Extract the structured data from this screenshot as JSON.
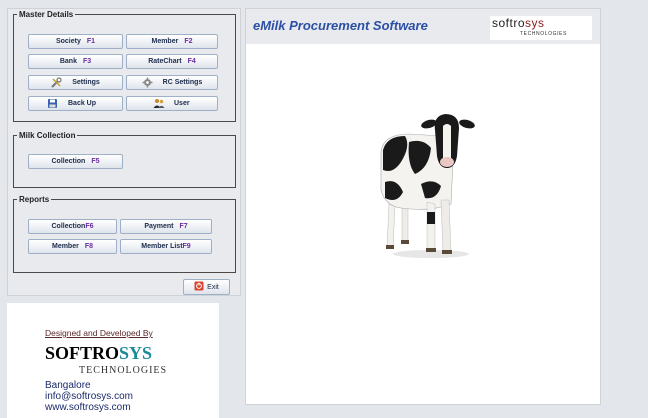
{
  "app": {
    "title": "eMilk Procurement Software"
  },
  "brand_logo": {
    "part1": "softro",
    "part2": "sys",
    "sub": "TECHNOLOGIES"
  },
  "master_details": {
    "legend": "Master Details",
    "buttons": [
      {
        "label": "Society",
        "key": "F1"
      },
      {
        "label": "Member",
        "key": "F2"
      },
      {
        "label": "Bank",
        "key": "F3"
      },
      {
        "label": "RateChart",
        "key": "F4"
      },
      {
        "label": "Settings",
        "key": ""
      },
      {
        "label": "RC Settings",
        "key": ""
      },
      {
        "label": "Back Up",
        "key": ""
      },
      {
        "label": "User",
        "key": ""
      }
    ]
  },
  "milk_collection": {
    "legend": "Milk Collection",
    "buttons": [
      {
        "label": "Collection",
        "key": "F5"
      }
    ]
  },
  "reports": {
    "legend": "Reports",
    "buttons": [
      {
        "label": "Collection",
        "key": "F6"
      },
      {
        "label": "Payment",
        "key": "F7"
      },
      {
        "label": "Member",
        "key": "F8"
      },
      {
        "label": "Member List",
        "key": "F9"
      }
    ]
  },
  "exit": {
    "label": "Exit"
  },
  "company": {
    "designed_by": "Designed and Developed By",
    "name_part1": "SOFTRO",
    "name_part2": "SYS",
    "sub": "TECHNOLOGIES",
    "city": "Bangalore",
    "email": "info@softrosys.com",
    "website": "www.softrosys.com"
  },
  "colors": {
    "title_blue": "#2c4fa6",
    "key_purple": "#6a2ca0",
    "brand_teal": "#1d8a99",
    "brand_red": "#8b1d1d"
  },
  "icons": {
    "settings": "tools-icon",
    "rc_settings": "gear-icon",
    "backup": "disk-icon",
    "user": "users-icon",
    "exit": "exit-icon"
  }
}
